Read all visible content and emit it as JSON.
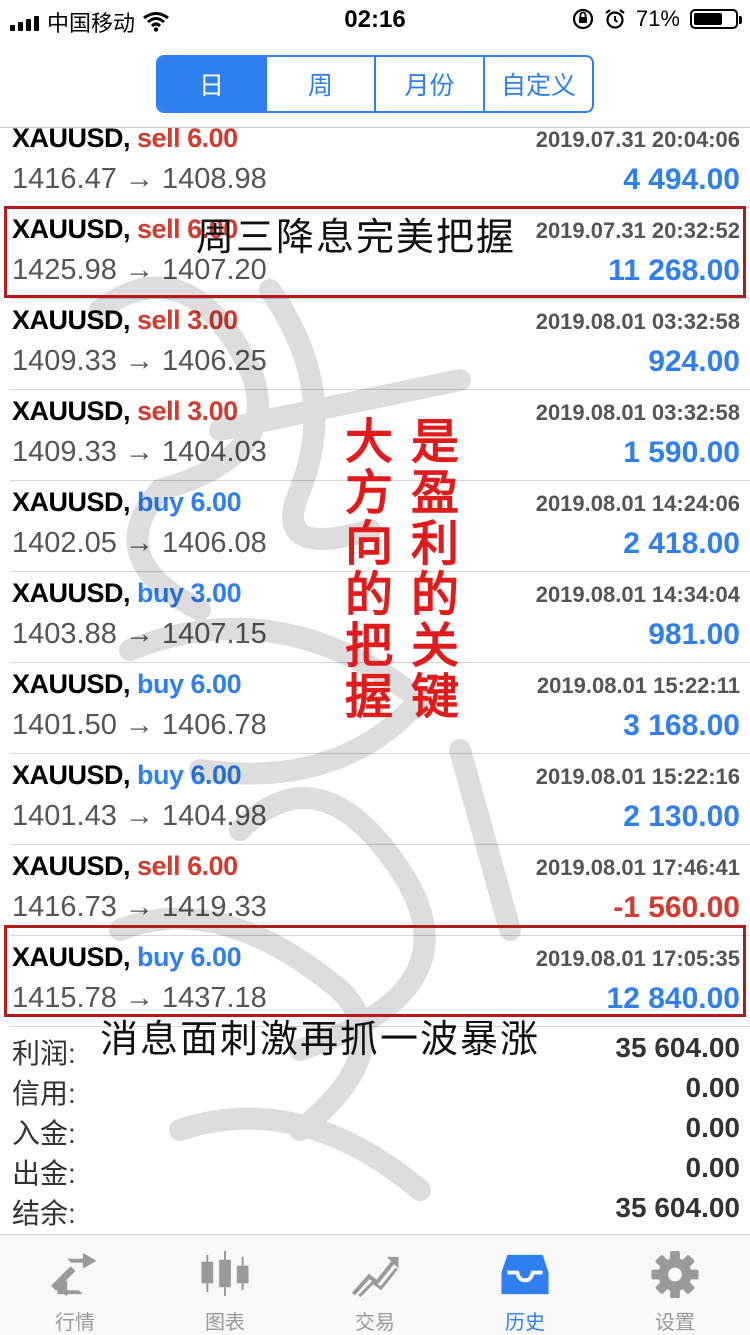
{
  "status_bar": {
    "carrier": "中国移动",
    "time": "02:16",
    "battery": "71%",
    "battery_level": 0.71
  },
  "period_tabs": [
    {
      "label": "日",
      "active": true
    },
    {
      "label": "周",
      "active": false
    },
    {
      "label": "月份",
      "active": false
    },
    {
      "label": "自定义",
      "active": false
    }
  ],
  "trades": [
    {
      "symbol": "XAUUSD,",
      "side": "sell",
      "volume": "6.00",
      "side_label": "sell 6.00",
      "prices": "1416.47 → 1408.98",
      "time": "2019.07.31 20:04:06",
      "profit": "4 494.00"
    },
    {
      "symbol": "XAUUSD,",
      "side": "sell",
      "volume": "6.00",
      "side_label": "sell 6.00",
      "prices": "1425.98 → 1407.20",
      "time": "2019.07.31 20:32:52",
      "profit": "11 268.00"
    },
    {
      "symbol": "XAUUSD,",
      "side": "sell",
      "volume": "3.00",
      "side_label": "sell 3.00",
      "prices": "1409.33 → 1406.25",
      "time": "2019.08.01 03:32:58",
      "profit": "924.00"
    },
    {
      "symbol": "XAUUSD,",
      "side": "sell",
      "volume": "3.00",
      "side_label": "sell 3.00",
      "prices": "1409.33 → 1404.03",
      "time": "2019.08.01 03:32:58",
      "profit": "1 590.00"
    },
    {
      "symbol": "XAUUSD,",
      "side": "buy",
      "volume": "6.00",
      "side_label": "buy 6.00",
      "prices": "1402.05 → 1406.08",
      "time": "2019.08.01 14:24:06",
      "profit": "2 418.00"
    },
    {
      "symbol": "XAUUSD,",
      "side": "buy",
      "volume": "3.00",
      "side_label": "buy 3.00",
      "prices": "1403.88 → 1407.15",
      "time": "2019.08.01 14:34:04",
      "profit": "981.00"
    },
    {
      "symbol": "XAUUSD,",
      "side": "buy",
      "volume": "6.00",
      "side_label": "buy 6.00",
      "prices": "1401.50 → 1406.78",
      "time": "2019.08.01 15:22:11",
      "profit": "3 168.00"
    },
    {
      "symbol": "XAUUSD,",
      "side": "buy",
      "volume": "6.00",
      "side_label": "buy 6.00",
      "prices": "1401.43 → 1404.98",
      "time": "2019.08.01 15:22:16",
      "profit": "2 130.00"
    },
    {
      "symbol": "XAUUSD,",
      "side": "sell",
      "volume": "6.00",
      "side_label": "sell 6.00",
      "prices": "1416.73 → 1419.33",
      "time": "2019.08.01 17:46:41",
      "profit": "-1 560.00"
    },
    {
      "symbol": "XAUUSD,",
      "side": "buy",
      "volume": "6.00",
      "side_label": "buy 6.00",
      "prices": "1415.78 → 1437.18",
      "time": "2019.08.01 17:05:35",
      "profit": "12 840.00"
    }
  ],
  "annotations": {
    "note_top": "周三降息完美把握",
    "note_vertical_left": "大方向的把握",
    "note_vertical_right": "是盈利的关键",
    "note_bottom": "消息面刺激再抓一波暴涨"
  },
  "summary": [
    {
      "label": "利润:",
      "value": "35 604.00"
    },
    {
      "label": "信用:",
      "value": "0.00"
    },
    {
      "label": "入金:",
      "value": "0.00"
    },
    {
      "label": "出金:",
      "value": "0.00"
    },
    {
      "label": "结余:",
      "value": "35 604.00"
    }
  ],
  "bottom_tabs": [
    {
      "label": "行情",
      "icon": "quotes-icon",
      "active": false
    },
    {
      "label": "图表",
      "icon": "chart-icon",
      "active": false
    },
    {
      "label": "交易",
      "icon": "trade-icon",
      "active": false
    },
    {
      "label": "历史",
      "icon": "history-icon",
      "active": true
    },
    {
      "label": "设置",
      "icon": "settings-icon",
      "active": false
    }
  ],
  "colors": {
    "accent": "#2f7ff0",
    "sell": "#d23b2f",
    "annotation_red": "#e01b1b",
    "box_red": "#b11b1b"
  }
}
